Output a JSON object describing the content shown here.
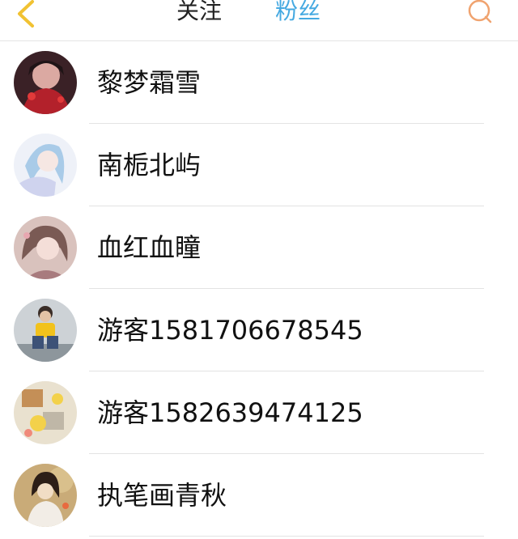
{
  "header": {
    "back_icon": "chevron-left-icon",
    "tabs": [
      {
        "label": "关注",
        "active": false
      },
      {
        "label": "粉丝",
        "active": true
      }
    ],
    "search_icon": "search-icon"
  },
  "colors": {
    "accent": "#45a9e1",
    "back_icon": "#f1c232",
    "search_icon": "#f0a36f",
    "text": "#111111",
    "divider": "#e3e3e3"
  },
  "fans": [
    {
      "name": "黎梦霜雪"
    },
    {
      "name": "南栀北屿"
    },
    {
      "name": "血红血瞳"
    },
    {
      "name": "游客1581706678545"
    },
    {
      "name": "游客1582639474125"
    },
    {
      "name": "执笔画青秋"
    }
  ]
}
